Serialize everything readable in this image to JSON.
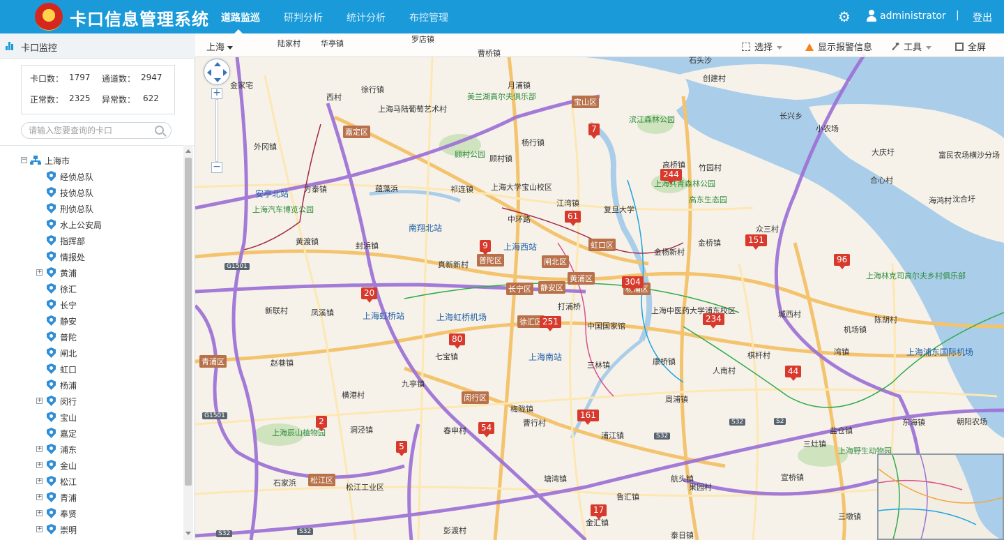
{
  "app": {
    "title": "卡口信息管理系统",
    "nav": [
      "道路监巡",
      "研判分析",
      "统计分析",
      "布控管理"
    ],
    "active_nav": "道路监巡",
    "username": "administrator",
    "separator": "|",
    "logout": "登出"
  },
  "sidebar": {
    "title": "卡口监控",
    "stats": {
      "checkpoints_label": "卡口数：",
      "checkpoints_value": "1797",
      "channels_label": "通道数：",
      "channels_value": "2947",
      "normal_label": "正常数：",
      "normal_value": "2325",
      "abnormal_label": "异常数：",
      "abnormal_value": "622"
    },
    "search_placeholder": "请输入您要查询的卡口",
    "tree": {
      "root": "上海市",
      "items": [
        {
          "label": "经侦总队",
          "expandable": false
        },
        {
          "label": "技侦总队",
          "expandable": false
        },
        {
          "label": "刑侦总队",
          "expandable": false
        },
        {
          "label": "水上公安局",
          "expandable": false
        },
        {
          "label": "指挥部",
          "expandable": false
        },
        {
          "label": "情报处",
          "expandable": false
        },
        {
          "label": "黄浦",
          "expandable": true
        },
        {
          "label": "徐汇",
          "expandable": false
        },
        {
          "label": "长宁",
          "expandable": false
        },
        {
          "label": "静安",
          "expandable": false
        },
        {
          "label": "普陀",
          "expandable": false
        },
        {
          "label": "闸北",
          "expandable": false
        },
        {
          "label": "虹口",
          "expandable": false
        },
        {
          "label": "杨浦",
          "expandable": false
        },
        {
          "label": "闵行",
          "expandable": true
        },
        {
          "label": "宝山",
          "expandable": false
        },
        {
          "label": "嘉定",
          "expandable": false
        },
        {
          "label": "浦东",
          "expandable": true
        },
        {
          "label": "金山",
          "expandable": true
        },
        {
          "label": "松江",
          "expandable": true
        },
        {
          "label": "青浦",
          "expandable": true
        },
        {
          "label": "奉贤",
          "expandable": true
        },
        {
          "label": "崇明",
          "expandable": true
        }
      ]
    }
  },
  "map": {
    "city": "上海",
    "toolbar": {
      "select": "选择",
      "alarm": "显示报警信息",
      "tools": "工具",
      "fullscreen": "全屏"
    },
    "markers": [
      "7",
      "244",
      "61",
      "9",
      "151",
      "96",
      "304",
      "20",
      "251",
      "234",
      "80",
      "44",
      "161",
      "2",
      "54",
      "5",
      "17"
    ],
    "districts": [
      "宝山区",
      "嘉定区",
      "虹口区",
      "普陀区",
      "闸北区",
      "静安区",
      "黄浦区",
      "长宁区",
      "杨浦区",
      "徐汇区",
      "青浦区",
      "闵行区",
      "松江区"
    ],
    "places": {
      "p1": "金家宅",
      "p2": "徐行镇",
      "p3": "西村",
      "p4": "上海马陆葡萄艺术村",
      "p5": "美兰湖高尔夫俱乐部",
      "p6": "月浦镇",
      "p7": "外冈镇",
      "p8": "杨行镇",
      "p9": "顾村公园",
      "p10": "顾村镇",
      "p11": "滨江森林公园",
      "p12": "高桥镇",
      "p13": "竹园村",
      "p14": "安亭北站",
      "p15": "方泰镇",
      "p16": "祁连镇",
      "p17": "上海大学宝山校区",
      "p18": "江湾镇",
      "p19": "复旦大学",
      "p20": "上海共青森林公园",
      "p21": "高东生态园",
      "p22": "上海汽车博览公园",
      "p23": "南翔北站",
      "p24": "中环路",
      "p25": "黄渡镇",
      "p26": "封浜镇",
      "p27": "上海西站",
      "p28": "真新新村",
      "p29": "金杨新村",
      "p30": "金桥镇",
      "p31": "众三村",
      "p32": "新联村",
      "p33": "凤溪镇",
      "p34": "上海虹桥站",
      "p35": "上海虹桥机场",
      "p36": "打浦桥",
      "p37": "中国国家馆",
      "p38": "上海中医药大学浦东校区",
      "p39": "城西村",
      "p40": "陈胡村",
      "p41": "上海林克司高尔夫乡村俱乐部",
      "p42": "赵巷镇",
      "p43": "七宝镇",
      "p44": "上海南站",
      "p45": "三林镇",
      "p46": "康桥镇",
      "p47": "人南村",
      "p48": "棋杆村",
      "p49": "湾镇",
      "p50": "上海浦东国际机场",
      "p51": "机场镇",
      "p52": "九亭镇",
      "p53": "横港村",
      "p54": "梅陇镇",
      "p55": "周浦镇",
      "p56": "上海辰山植物园",
      "p57": "洞泾镇",
      "p58": "春申村",
      "p59": "曹行村",
      "p60": "浦江镇",
      "p61": "盐仓镇",
      "p62": "东海镇",
      "p63": "朝阳农场",
      "p64": "三灶镇",
      "p65": "上海野生动物园",
      "p66": "石家浜",
      "p67": "松江工业区",
      "p68": "塘湾镇",
      "p69": "航头镇",
      "p70": "果园村",
      "p71": "宣桥镇",
      "p72": "鲁汇镇",
      "p73": "金汇镇",
      "p74": "彭渡村",
      "p75": "泰日镇",
      "p76": "三墩镇",
      "p77": "石头沙",
      "p78": "创建村",
      "p79": "长兴乡",
      "p80": "小农场",
      "p81": "大庆圩",
      "p82": "富民农场横沙分场",
      "p83": "合心村",
      "p84": "海鸿村",
      "p85": "沈合圩",
      "p86": "陆家村",
      "p87": "华亭镇",
      "p88": "罗店镇",
      "p89": "蕴藻浜",
      "p90": "曹桥镇"
    },
    "highways": [
      "G1501",
      "G1501",
      "S32",
      "S2",
      "S32",
      "S32",
      "S32"
    ]
  }
}
